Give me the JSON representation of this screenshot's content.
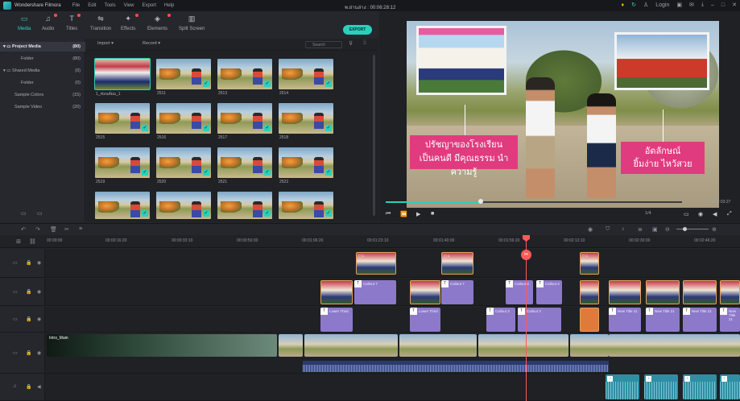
{
  "app": {
    "name": "Wondershare Filmora",
    "menu": [
      "File",
      "Edit",
      "Tools",
      "View",
      "Export",
      "Help"
    ],
    "project_title": "พ.ย่านล่าง : 00:06:28:12",
    "login": "Login"
  },
  "toolbar": {
    "tools": [
      {
        "label": "Media",
        "icon": "folder-icon",
        "active": true
      },
      {
        "label": "Audio",
        "icon": "music-note-icon"
      },
      {
        "label": "Titles",
        "icon": "text-icon"
      },
      {
        "label": "Transition",
        "icon": "transition-icon"
      },
      {
        "label": "Effects",
        "icon": "effects-icon"
      },
      {
        "label": "Elements",
        "icon": "elements-icon"
      },
      {
        "label": "Split Screen",
        "icon": "split-screen-icon"
      }
    ],
    "export_label": "EXPORT"
  },
  "tree": {
    "items": [
      {
        "label": "Project Media",
        "count": "(80)"
      },
      {
        "label": "Folder",
        "count": "(80)"
      },
      {
        "label": "Shared Media",
        "count": "(0)"
      },
      {
        "label": "Folder",
        "count": "(0)"
      },
      {
        "label": "Sample Colors",
        "count": "(15)"
      },
      {
        "label": "Sample Video",
        "count": "(20)"
      }
    ]
  },
  "media": {
    "import_label": "Import",
    "record_label": "Record",
    "search_placeholder": "Search",
    "thumbs": [
      "1_ฟอนต์ผม_1",
      "2511",
      "2513",
      "2514",
      "2515",
      "2516",
      "2517",
      "2518",
      "2519",
      "2520",
      "2521",
      "2522"
    ]
  },
  "preview": {
    "caption_left_1": "ปรัชญาของโรงเรียน",
    "caption_left_2": "เป็นคนดี มีคุณธรรม นำความรู้",
    "caption_right_1": "อัตลักษณ์",
    "caption_right_2": "ยิ้มง่าย ไหว้สวย",
    "timecode": "00:02:03:27",
    "ratio": "1/4",
    "seek_fraction": 0.32
  },
  "ruler": {
    "ticks": [
      "00:00:00",
      "00:00:16:20",
      "00:00:33:10",
      "00:00:50:00",
      "00:01:06:20",
      "00:01:23:10",
      "00:01:40:00",
      "00:01:56:20",
      "00:02:13:10",
      "00:02:30:00",
      "00:02:46:20"
    ]
  },
  "timeline": {
    "title_clips": [
      "Callout 7",
      "Callout 7",
      "Callout 7",
      "Callout 4",
      "Callout 4",
      "Callout 3",
      "New Title 22",
      "New Title 22",
      "New Title 22",
      "New Title 22"
    ],
    "lower_thirds": [
      "Lower Third",
      "Lower Third",
      "Callout 3",
      "Callout 3",
      "New Title 21",
      "New Title 21",
      "New Title 21",
      "New Title 21"
    ],
    "intro_label": "Intro_Main"
  }
}
